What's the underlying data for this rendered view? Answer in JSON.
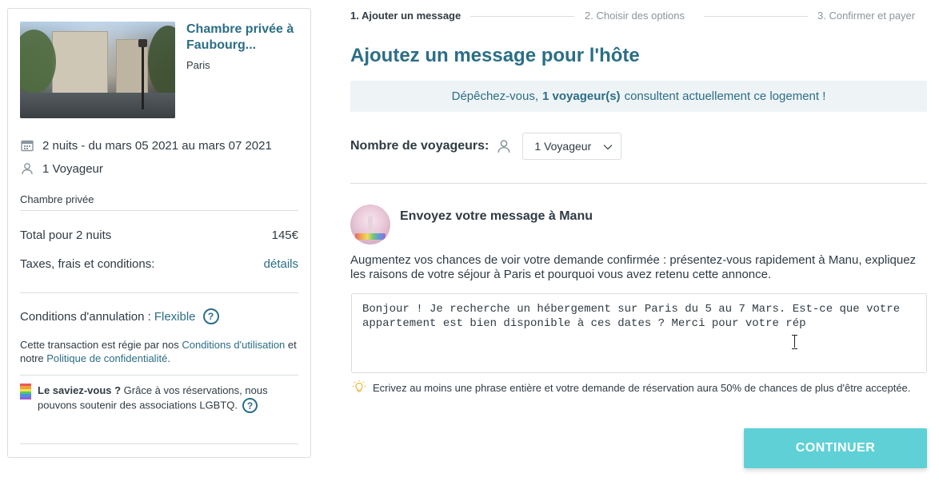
{
  "listing": {
    "title": "Chambre privée à Faubourg...",
    "city": "Paris",
    "dates": "2 nuits - du mars 05 2021 au mars 07 2021",
    "guests": "1 Voyageur",
    "room_type": "Chambre privée"
  },
  "pricing": {
    "total_label": "Total pour 2 nuits",
    "total_value": "145€",
    "tax_label": "Taxes, frais et conditions:",
    "tax_link": "détails"
  },
  "cancellation": {
    "label": "Conditions d'annulation :",
    "policy": "Flexible",
    "help": "?"
  },
  "terms": {
    "text_1": "Cette transaction est régie par nos ",
    "link_1": "Conditions d'utilisation",
    "text_2": " et notre ",
    "link_2": "Politique de confidentialité",
    "text_3": "."
  },
  "did_you_know": {
    "title": "Le saviez-vous ?",
    "text": " Grâce à vos réservations, nous pouvons soutenir des associations LGBTQ.",
    "help": "?",
    "flag_colors": [
      "#e85a5a",
      "#f0a23a",
      "#f2e04a",
      "#5cc46a",
      "#4a90e2",
      "#9a5cd0"
    ]
  },
  "steps": [
    {
      "label": "1. Ajouter un message",
      "active": true
    },
    {
      "label": "2. Choisir des options",
      "active": false
    },
    {
      "label": "3. Confirmer et payer",
      "active": false
    }
  ],
  "heading": "Ajoutez un message pour l'hôte",
  "urgency": {
    "prefix": "Dépêchez-vous,",
    "count": "1 voyageur(s)",
    "suffix": "consultent actuellement ce logement !"
  },
  "travelers": {
    "label": "Nombre de voyageurs:",
    "selected": "1 Voyageur"
  },
  "host": {
    "send_title": "Envoyez votre message à Manu"
  },
  "intro": "Augmentez vos chances de voir votre demande confirmée : présentez-vous rapidement à Manu, expliquez les raisons de votre séjour à Paris et pourquoi vous avez retenu cette annonce.",
  "message_value": "Bonjour ! Je recherche un hébergement sur Paris du 5 au 7 Mars. Est-ce que votre appartement est bien disponible à ces dates ? Merci pour votre rép",
  "hint": "Ecrivez au moins une phrase entière et votre demande de réservation aura 50% de chances de plus d'être acceptée.",
  "continue_label": "CONTINUER",
  "colors": {
    "brand": "#2b6e86",
    "accent_button": "#5fd1d6",
    "urgency_bg": "#eef3f6"
  },
  "icons": {
    "dates": "calendar-icon",
    "guests": "user-icon",
    "hint": "lightbulb-icon",
    "select": "chevron-down-icon"
  }
}
